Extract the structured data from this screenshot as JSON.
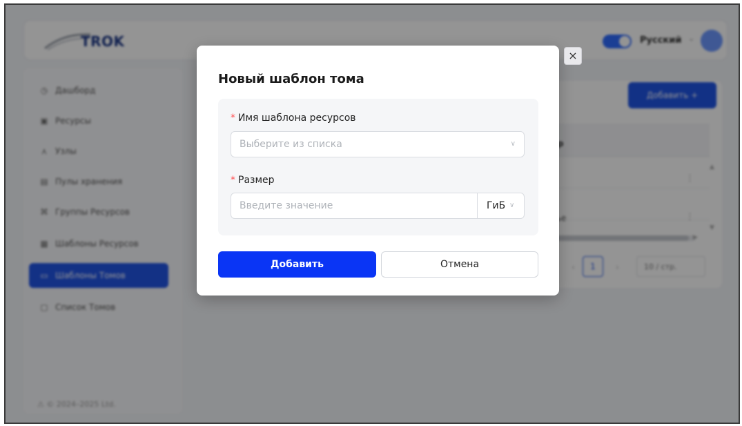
{
  "header": {
    "logo_text": "TROK",
    "language": "Русский"
  },
  "sidebar": {
    "items": [
      {
        "label": "Дашборд",
        "icon": "dashboard-icon"
      },
      {
        "label": "Ресурсы",
        "icon": "resources-icon"
      },
      {
        "label": "Узлы",
        "icon": "nodes-icon"
      },
      {
        "label": "Пулы хранения",
        "icon": "storage-pool-icon"
      },
      {
        "label": "Группы Ресурсов",
        "icon": "resource-group-icon"
      },
      {
        "label": "Шаблоны Ресурсов",
        "icon": "resource-template-icon"
      },
      {
        "label": "Шаблоны Томов",
        "icon": "volume-template-icon",
        "active": true
      },
      {
        "label": "Список Томов",
        "icon": "volume-list-icon"
      }
    ],
    "footer": "© 2024–2025 Ltd."
  },
  "main": {
    "add_button": "Добавить +",
    "column_header": "мр",
    "row2_cell": "нье",
    "pagination": {
      "current_page": "1",
      "page_size": "10 / стр."
    }
  },
  "modal": {
    "title": "Новый шаблон тома",
    "close_symbol": "×",
    "fields": {
      "template_name": {
        "required_mark": "*",
        "label": "Имя шаблона ресурсов",
        "placeholder": "Выберите из списка"
      },
      "size": {
        "required_mark": "*",
        "label": "Размер",
        "placeholder": "Введите значение",
        "unit": "ГиБ"
      }
    },
    "submit_label": "Добавить",
    "cancel_label": "Отмена"
  },
  "colors": {
    "primary": "#0a35f5",
    "required": "#ff4d4f",
    "active_nav": "#2255e6"
  }
}
